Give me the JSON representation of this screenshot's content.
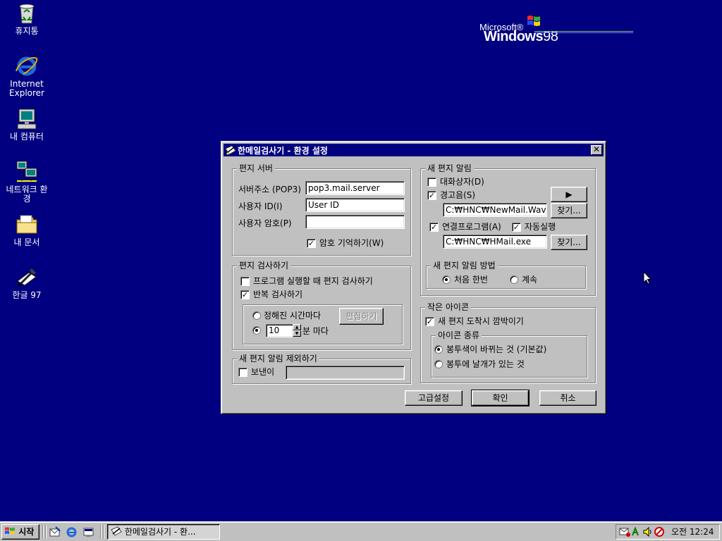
{
  "desktop": {
    "icons": [
      {
        "label": "휴지통"
      },
      {
        "label": "Internet Explorer"
      },
      {
        "label": "내 컴퓨터"
      },
      {
        "label": "네트워크 환경"
      },
      {
        "label": "내 문서"
      },
      {
        "label": "한글 97"
      }
    ],
    "logo": {
      "brand": "Microsoft®",
      "product": "Windows",
      "version": "98"
    }
  },
  "dialog": {
    "title": "한메일검사기 - 환경 설정",
    "close_glyph": "✕",
    "server": {
      "legend": "편지 서버",
      "address_label": "서버주소 (POP3)",
      "address_value": "pop3.mail.server",
      "user_id_label": "사용자 ID(I)",
      "user_id_value": "User ID",
      "password_label": "사용자 암호(P)",
      "password_value": "",
      "remember_label": "암호 기억하기(W)",
      "remember_checked": true
    },
    "check": {
      "legend": "편지 검사하기",
      "on_start_label": "프로그램 실행할 때 편지 검사하기",
      "on_start_checked": false,
      "repeat_label": "반복 검사하기",
      "repeat_checked": true,
      "fixed_time_label": "정해진 시간마다",
      "edit_button": "편집하기",
      "interval_value": "10",
      "interval_unit": "분 마다",
      "selected_mode": "interval"
    },
    "exclude": {
      "legend": "새 편지 알림 제외하기",
      "sender_label": "보낸이",
      "sender_checked": false,
      "sender_value": ""
    },
    "notify": {
      "legend": "새 편지 알림",
      "dialog_label": "대화상자(D)",
      "dialog_checked": false,
      "sound_label": "경고음(S)",
      "sound_checked": true,
      "play_glyph": "▶",
      "sound_path": "C:₩HNC₩NewMail.Wav",
      "browse_label": "찾기...",
      "program_label": "연결프로그램(A)",
      "program_checked": true,
      "autorun_label": "자동실행",
      "autorun_checked": true,
      "program_path": "C:₩HNC₩HMail.exe",
      "method": {
        "legend": "새 편지 알림 방법",
        "once_label": "처음 한번",
        "continuous_label": "계속",
        "selected": "once"
      }
    },
    "small_icon": {
      "legend": "작은 아이콘",
      "blink_label": "새 편지 도착시 깜박이기",
      "blink_checked": true,
      "kind": {
        "legend": "아이콘 종류",
        "color_label": "봉투색이 바뀌는 것 (기본값)",
        "wing_label": "봉투에 날개가 있는 것",
        "selected": "color"
      }
    },
    "buttons": {
      "advanced": "고급설정",
      "ok": "확인",
      "cancel": "취소"
    }
  },
  "taskbar": {
    "start_label": "시작",
    "task_label": "한메일검사기 - 환...",
    "clock": "오전 12:24"
  },
  "colors": {
    "desktop": "#000080",
    "titlebar": "#000080",
    "face": "#c0c0c0"
  }
}
